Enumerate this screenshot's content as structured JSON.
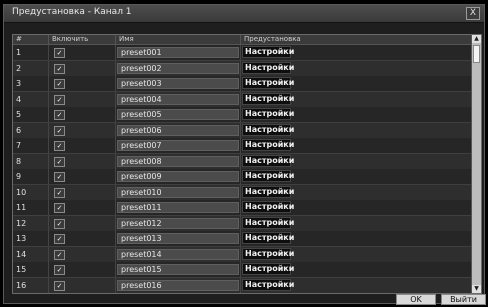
{
  "window": {
    "title": "Предустановка - Канал 1",
    "close_label": "X"
  },
  "table": {
    "headers": {
      "num": "#",
      "enable": "Включить",
      "name": "Имя",
      "preset": "Предустановка"
    },
    "rows": [
      {
        "num": "1",
        "checked": "✓",
        "name": "preset001",
        "action": "Настройки"
      },
      {
        "num": "2",
        "checked": "✓",
        "name": "preset002",
        "action": "Настройки"
      },
      {
        "num": "3",
        "checked": "✓",
        "name": "preset003",
        "action": "Настройки"
      },
      {
        "num": "4",
        "checked": "✓",
        "name": "preset004",
        "action": "Настройки"
      },
      {
        "num": "5",
        "checked": "✓",
        "name": "preset005",
        "action": "Настройки"
      },
      {
        "num": "6",
        "checked": "✓",
        "name": "preset006",
        "action": "Настройки"
      },
      {
        "num": "7",
        "checked": "✓",
        "name": "preset007",
        "action": "Настройки"
      },
      {
        "num": "8",
        "checked": "✓",
        "name": "preset008",
        "action": "Настройки"
      },
      {
        "num": "9",
        "checked": "✓",
        "name": "preset009",
        "action": "Настройки"
      },
      {
        "num": "10",
        "checked": "✓",
        "name": "preset010",
        "action": "Настройки"
      },
      {
        "num": "11",
        "checked": "✓",
        "name": "preset011",
        "action": "Настройки"
      },
      {
        "num": "12",
        "checked": "✓",
        "name": "preset012",
        "action": "Настройки"
      },
      {
        "num": "13",
        "checked": "✓",
        "name": "preset013",
        "action": "Настройки"
      },
      {
        "num": "14",
        "checked": "✓",
        "name": "preset014",
        "action": "Настройки"
      },
      {
        "num": "15",
        "checked": "✓",
        "name": "preset015",
        "action": "Настройки"
      },
      {
        "num": "16",
        "checked": "✓",
        "name": "preset016",
        "action": "Настройки"
      }
    ]
  },
  "footer": {
    "ok_label": "OK",
    "exit_label": "Выйти"
  }
}
